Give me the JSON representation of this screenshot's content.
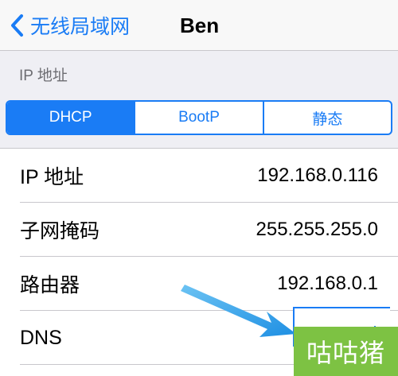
{
  "navbar": {
    "back_label": "无线局域网",
    "title": "Ben"
  },
  "section": {
    "title": "IP 地址"
  },
  "segments": [
    {
      "label": "DHCP",
      "active": true
    },
    {
      "label": "BootP",
      "active": false
    },
    {
      "label": "静态",
      "active": false
    }
  ],
  "rows": [
    {
      "label": "IP 地址",
      "value": "192.168.0.116"
    },
    {
      "label": "子网掩码",
      "value": "255.255.255.0"
    },
    {
      "label": "路由器",
      "value": "192.168.0.1"
    },
    {
      "label": "DNS",
      "value": ""
    }
  ],
  "watermark": {
    "text": "咕咕猪"
  },
  "colors": {
    "accent": "#1a7cf5",
    "watermark_bg": "#7dc243",
    "arrow": "#2f9ee9"
  }
}
